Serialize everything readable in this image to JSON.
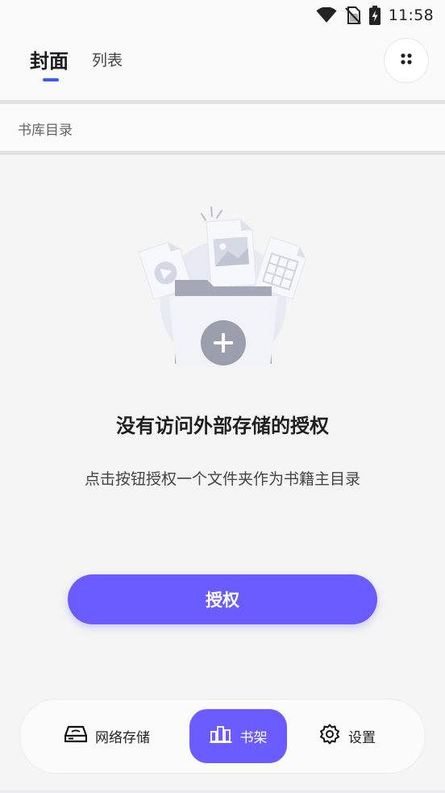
{
  "statusbar": {
    "time": "11:58",
    "icons": [
      "wifi-icon",
      "no-sim-icon",
      "battery-charging-icon"
    ]
  },
  "header": {
    "tabs": [
      {
        "label": "封面",
        "active": true
      },
      {
        "label": "列表",
        "active": false
      }
    ],
    "menu_icon": "dots-grid-icon",
    "accent_color": "#3d5afe"
  },
  "breadcrumb": {
    "path": "书库目录"
  },
  "empty_state": {
    "title": "没有访问外部存储的授权",
    "description": "点击按钮授权一个文件夹作为书籍主目录",
    "illustration": "folder-with-files-plus-icon"
  },
  "auth_button": {
    "label": "授权",
    "color": "#6a5cff"
  },
  "bottom_nav": {
    "items": [
      {
        "label": "网络存储",
        "icon": "network-drive-icon",
        "active": false
      },
      {
        "label": "书架",
        "icon": "bookshelf-icon",
        "active": true
      },
      {
        "label": "设置",
        "icon": "gear-icon",
        "active": false
      }
    ],
    "active_color": "#6a5cff"
  }
}
